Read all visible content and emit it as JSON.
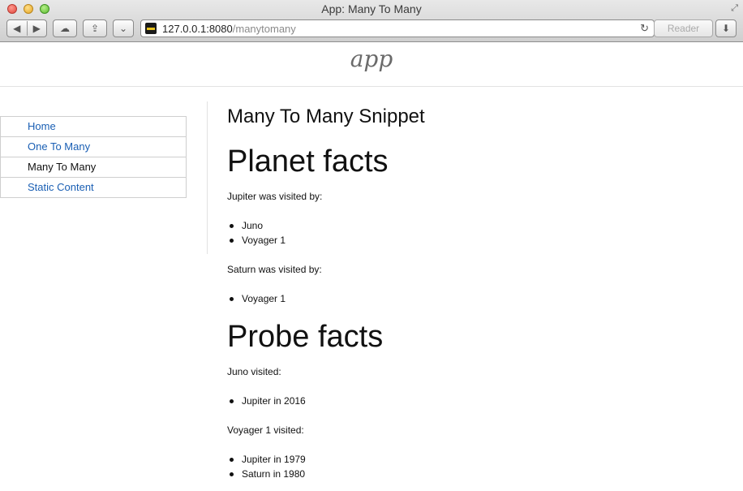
{
  "window": {
    "title": "App: Many To Many"
  },
  "toolbar": {
    "url_host": "127.0.0.1:8080",
    "url_path": "/manytomany",
    "reader_label": "Reader"
  },
  "header": {
    "brand": "app"
  },
  "sidebar": {
    "items": [
      {
        "label": "Home",
        "current": false
      },
      {
        "label": "One To Many",
        "current": false
      },
      {
        "label": "Many To Many",
        "current": true
      },
      {
        "label": "Static Content",
        "current": false
      }
    ]
  },
  "main": {
    "snippet_title": "Many To Many Snippet",
    "planet_heading": "Planet facts",
    "planets": [
      {
        "intro": "Jupiter was visited by:",
        "items": [
          "Juno",
          "Voyager 1"
        ]
      },
      {
        "intro": "Saturn was visited by:",
        "items": [
          "Voyager 1"
        ]
      }
    ],
    "probe_heading": "Probe facts",
    "probes": [
      {
        "intro": "Juno visited:",
        "items": [
          "Jupiter in 2016"
        ]
      },
      {
        "intro": "Voyager 1 visited:",
        "items": [
          "Jupiter in 1979",
          "Saturn in 1980"
        ]
      }
    ]
  },
  "colors": {
    "link": "#1a5fb4",
    "text": "#111111"
  }
}
